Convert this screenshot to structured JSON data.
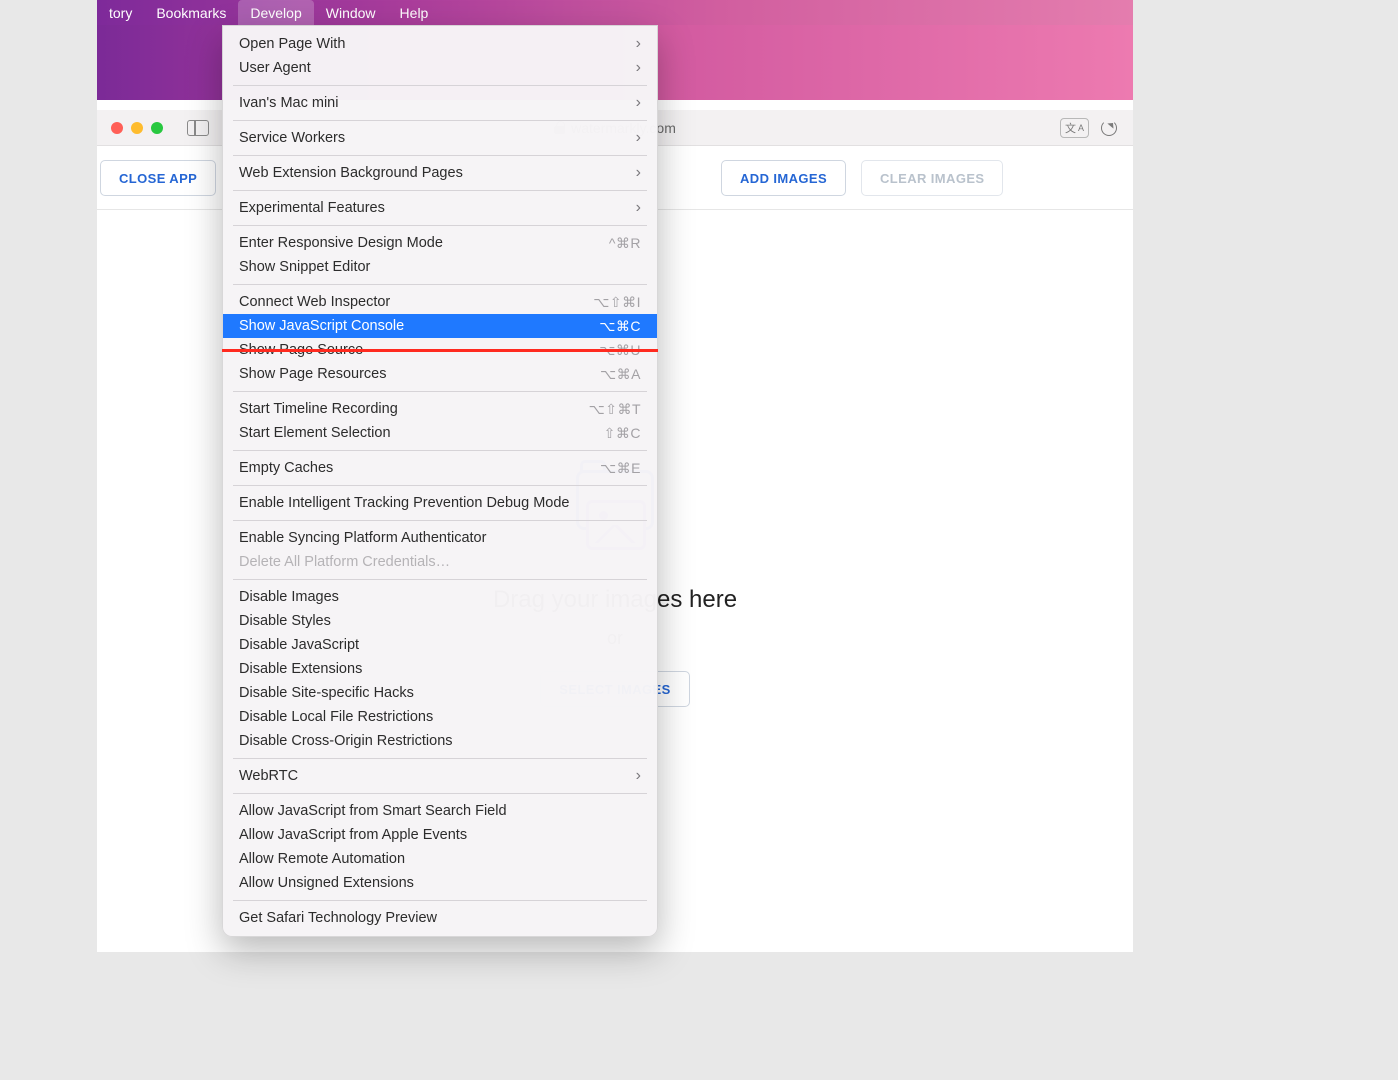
{
  "menubar": {
    "items": [
      "tory",
      "Bookmarks",
      "Develop",
      "Window",
      "Help"
    ],
    "active_index": 2
  },
  "address_bar": {
    "url_display": "watermarkly.com"
  },
  "app_toolbar": {
    "close_label": "CLOSE APP",
    "add_label": "ADD IMAGES",
    "clear_label": "CLEAR IMAGES"
  },
  "drop_area": {
    "headline": "Drag your images here",
    "or_label": "or",
    "select_label": "SELECT IMAGES"
  },
  "develop_menu": {
    "groups": [
      [
        {
          "label": "Open Page With",
          "submenu": true
        },
        {
          "label": "User Agent",
          "submenu": true
        }
      ],
      [
        {
          "label": "Ivan's Mac mini",
          "submenu": true
        }
      ],
      [
        {
          "label": "Service Workers",
          "submenu": true
        }
      ],
      [
        {
          "label": "Web Extension Background Pages",
          "submenu": true
        }
      ],
      [
        {
          "label": "Experimental Features",
          "submenu": true
        }
      ],
      [
        {
          "label": "Enter Responsive Design Mode",
          "shortcut": "^⌘R"
        },
        {
          "label": "Show Snippet Editor"
        }
      ],
      [
        {
          "label": "Connect Web Inspector",
          "shortcut": "⌥⇧⌘I"
        },
        {
          "label": "Show JavaScript Console",
          "shortcut": "⌥⌘C",
          "highlight": true
        },
        {
          "label": "Show Page Source",
          "shortcut": "⌥⌘U"
        },
        {
          "label": "Show Page Resources",
          "shortcut": "⌥⌘A"
        }
      ],
      [
        {
          "label": "Start Timeline Recording",
          "shortcut": "⌥⇧⌘T"
        },
        {
          "label": "Start Element Selection",
          "shortcut": "⇧⌘C"
        }
      ],
      [
        {
          "label": "Empty Caches",
          "shortcut": "⌥⌘E"
        }
      ],
      [
        {
          "label": "Enable Intelligent Tracking Prevention Debug Mode"
        }
      ],
      [
        {
          "label": "Enable Syncing Platform Authenticator"
        },
        {
          "label": "Delete All Platform Credentials…",
          "disabled": true
        }
      ],
      [
        {
          "label": "Disable Images"
        },
        {
          "label": "Disable Styles"
        },
        {
          "label": "Disable JavaScript"
        },
        {
          "label": "Disable Extensions"
        },
        {
          "label": "Disable Site-specific Hacks"
        },
        {
          "label": "Disable Local File Restrictions"
        },
        {
          "label": "Disable Cross-Origin Restrictions"
        }
      ],
      [
        {
          "label": "WebRTC",
          "submenu": true
        }
      ],
      [
        {
          "label": "Allow JavaScript from Smart Search Field"
        },
        {
          "label": "Allow JavaScript from Apple Events"
        },
        {
          "label": "Allow Remote Automation"
        },
        {
          "label": "Allow Unsigned Extensions"
        }
      ],
      [
        {
          "label": "Get Safari Technology Preview"
        }
      ]
    ]
  }
}
